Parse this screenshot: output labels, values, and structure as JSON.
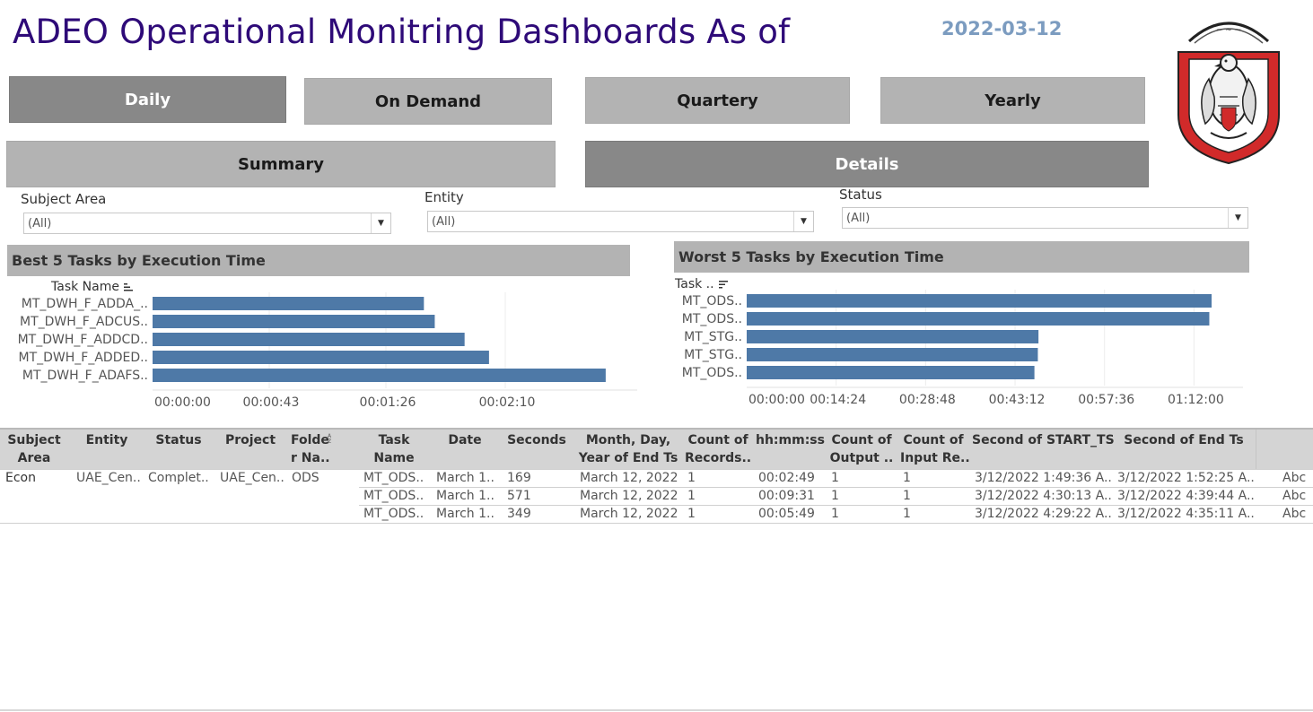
{
  "header": {
    "title": "ADEO Operational Monitring Dashboards As of",
    "date": "2022-03-12"
  },
  "nav": {
    "daily": "Daily",
    "on_demand": "On Demand",
    "quarterly": "Quartery",
    "yearly": "Yearly",
    "summary": "Summary",
    "details": "Details"
  },
  "filters": {
    "subject_area": {
      "label": "Subject Area",
      "value": "(All)"
    },
    "entity": {
      "label": "Entity",
      "value": "(All)"
    },
    "status": {
      "label": "Status",
      "value": "(All)"
    }
  },
  "best_chart": {
    "header": "Best 5 Tasks by Execution Time",
    "axis_field": "Task Name",
    "sort_icon": "sort-ascending-icon"
  },
  "worst_chart": {
    "header": "Worst 5 Tasks by Execution Time",
    "axis_field": "Task ..",
    "sort_icon": "sort-descending-icon"
  },
  "chart_data": [
    {
      "type": "bar",
      "orientation": "horizontal",
      "title": "Best 5 Tasks by Execution Time",
      "ylabel": "Task Name",
      "categories": [
        "MT_DWH_F_ADDA_..",
        "MT_DWH_F_ADCUS..",
        "MT_DWH_F_ADDCD..",
        "MT_DWH_F_ADDED..",
        "MT_DWH_F_ADAFS.."
      ],
      "values": [
        100,
        104,
        115,
        124,
        167
      ],
      "value_unit": "seconds",
      "xlim": [
        0,
        172
      ],
      "ticks": [
        0,
        43,
        86,
        130
      ],
      "tick_labels": [
        "00:00:00",
        "00:00:43",
        "00:01:26",
        "00:02:10"
      ],
      "color": "#4e79a7",
      "grid": true
    },
    {
      "type": "bar",
      "orientation": "horizontal",
      "title": "Worst 5 Tasks by Execution Time",
      "ylabel": "Task ..",
      "categories": [
        "MT_ODS..",
        "MT_ODS..",
        "MT_STG..",
        "MT_STG..",
        "MT_ODS.."
      ],
      "values": [
        4490,
        4468,
        2818,
        2812,
        2779
      ],
      "value_unit": "seconds",
      "xlim": [
        0,
        4620
      ],
      "ticks": [
        0,
        864,
        1728,
        2592,
        3456,
        4320
      ],
      "tick_labels": [
        "00:00:00",
        "00:14:24",
        "00:28:48",
        "00:43:12",
        "00:57:36",
        "01:12:00"
      ],
      "color": "#4e79a7",
      "grid": true
    }
  ],
  "table": {
    "columns": [
      "Subject\nArea",
      "Entity",
      "Status",
      "Project",
      "Folde\nr Na..",
      "Task\nName",
      "Date",
      "Seconds",
      "Month, Day,\nYear of End Ts",
      "Count of\nRecords..",
      "hh:mm:ss",
      "Count of\nOutput ..",
      "Count of\nInput Re..",
      "Second of START_TS",
      "Second of End Ts"
    ],
    "group": {
      "subject_area": "Econ",
      "entity": "UAE_Cen..",
      "status": "Complet..",
      "project": "UAE_Cen..",
      "folder": "ODS"
    },
    "rows": [
      {
        "task": "MT_ODS..",
        "date": "March 1..",
        "seconds": "169",
        "end_date": "March 12, 2022",
        "records": "1",
        "hms": "00:02:49",
        "output": "1",
        "input": "1",
        "start_ts": "3/12/2022 1:49:36 A..",
        "end_ts": "3/12/2022 1:52:25 A..",
        "extra": "Abc"
      },
      {
        "task": "MT_ODS..",
        "date": "March 1..",
        "seconds": "571",
        "end_date": "March 12, 2022",
        "records": "1",
        "hms": "00:09:31",
        "output": "1",
        "input": "1",
        "start_ts": "3/12/2022 4:30:13 A..",
        "end_ts": "3/12/2022 4:39:44 A..",
        "extra": "Abc"
      },
      {
        "task": "MT_ODS..",
        "date": "March 1..",
        "seconds": "349",
        "end_date": "March 12, 2022",
        "records": "1",
        "hms": "00:05:49",
        "output": "1",
        "input": "1",
        "start_ts": "3/12/2022 4:29:22 A..",
        "end_ts": "3/12/2022 4:35:11 A..",
        "extra": "Abc"
      }
    ]
  },
  "colors": {
    "title": "#2e0a78",
    "date": "#7c9cc0",
    "bar": "#4e79a7",
    "button_light": "#b3b3b3",
    "button_dark": "#888888",
    "logo_red": "#d12a2a"
  }
}
